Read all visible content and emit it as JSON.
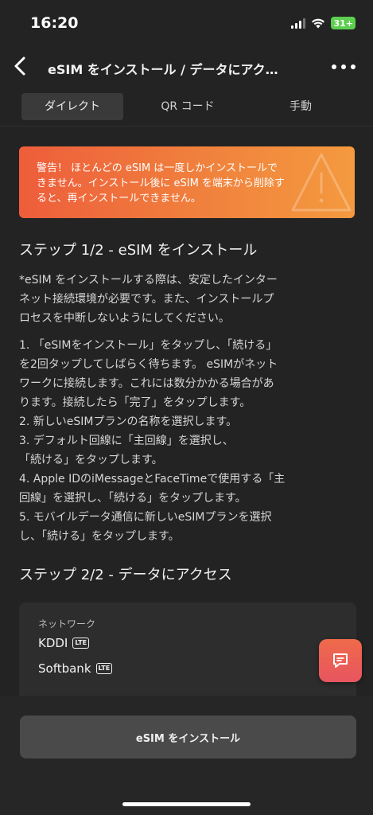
{
  "status_bar": {
    "time": "16:20",
    "battery": "31+"
  },
  "nav": {
    "title": "eSIM をインストール / データにアク…"
  },
  "tabs": [
    {
      "label": "ダイレクト",
      "active": true
    },
    {
      "label": "QR コード",
      "active": false
    },
    {
      "label": "手動",
      "active": false
    }
  ],
  "warning": {
    "line1": "警告！ ほとんどの eSIM は一度しかインストールで",
    "line2": "きません。インストール後に eSIM を端末から削除す",
    "line3": "ると、再インストールできません。"
  },
  "step1": {
    "title": "ステップ 1/2 - eSIM をインストール",
    "note": [
      "*eSIM をインストールする際は、安定したインター",
      "ネット接続環境が必要です。また、インストールプ",
      "ロセスを中断しないようにしてください。"
    ],
    "instructions": [
      "1. 「eSIMをインストール」をタップし、「続ける」",
      "を2回タップしてしばらく待ちます。 eSIMがネット",
      "ワークに接続します。これには数分かかる場合があ",
      "ります。接続したら「完了」をタップします。",
      "2. 新しいeSIMプランの名称を選択します。",
      "3. デフォルト回線に「主回線」を選択し、",
      "「続ける」をタップします。",
      "4. Apple IDのiMessageとFaceTimeで使用する「主",
      "回線」を選択し、「続ける」をタップします。",
      "5. モバイルデータ通信に新しいeSIMプランを選択",
      "し、「続ける」をタップします。"
    ]
  },
  "step2": {
    "title": "ステップ 2/2 - データにアクセス"
  },
  "network": {
    "label": "ネットワーク",
    "carriers": [
      {
        "name": "KDDI",
        "badge": "LTE"
      },
      {
        "name": "Softbank",
        "badge": "LTE"
      }
    ]
  },
  "install_button": {
    "label": "eSIM をインストール"
  },
  "colors": {
    "accent": "#EE5D3B",
    "warning_end": "#F49A3F",
    "battery": "#5CCF4F"
  }
}
